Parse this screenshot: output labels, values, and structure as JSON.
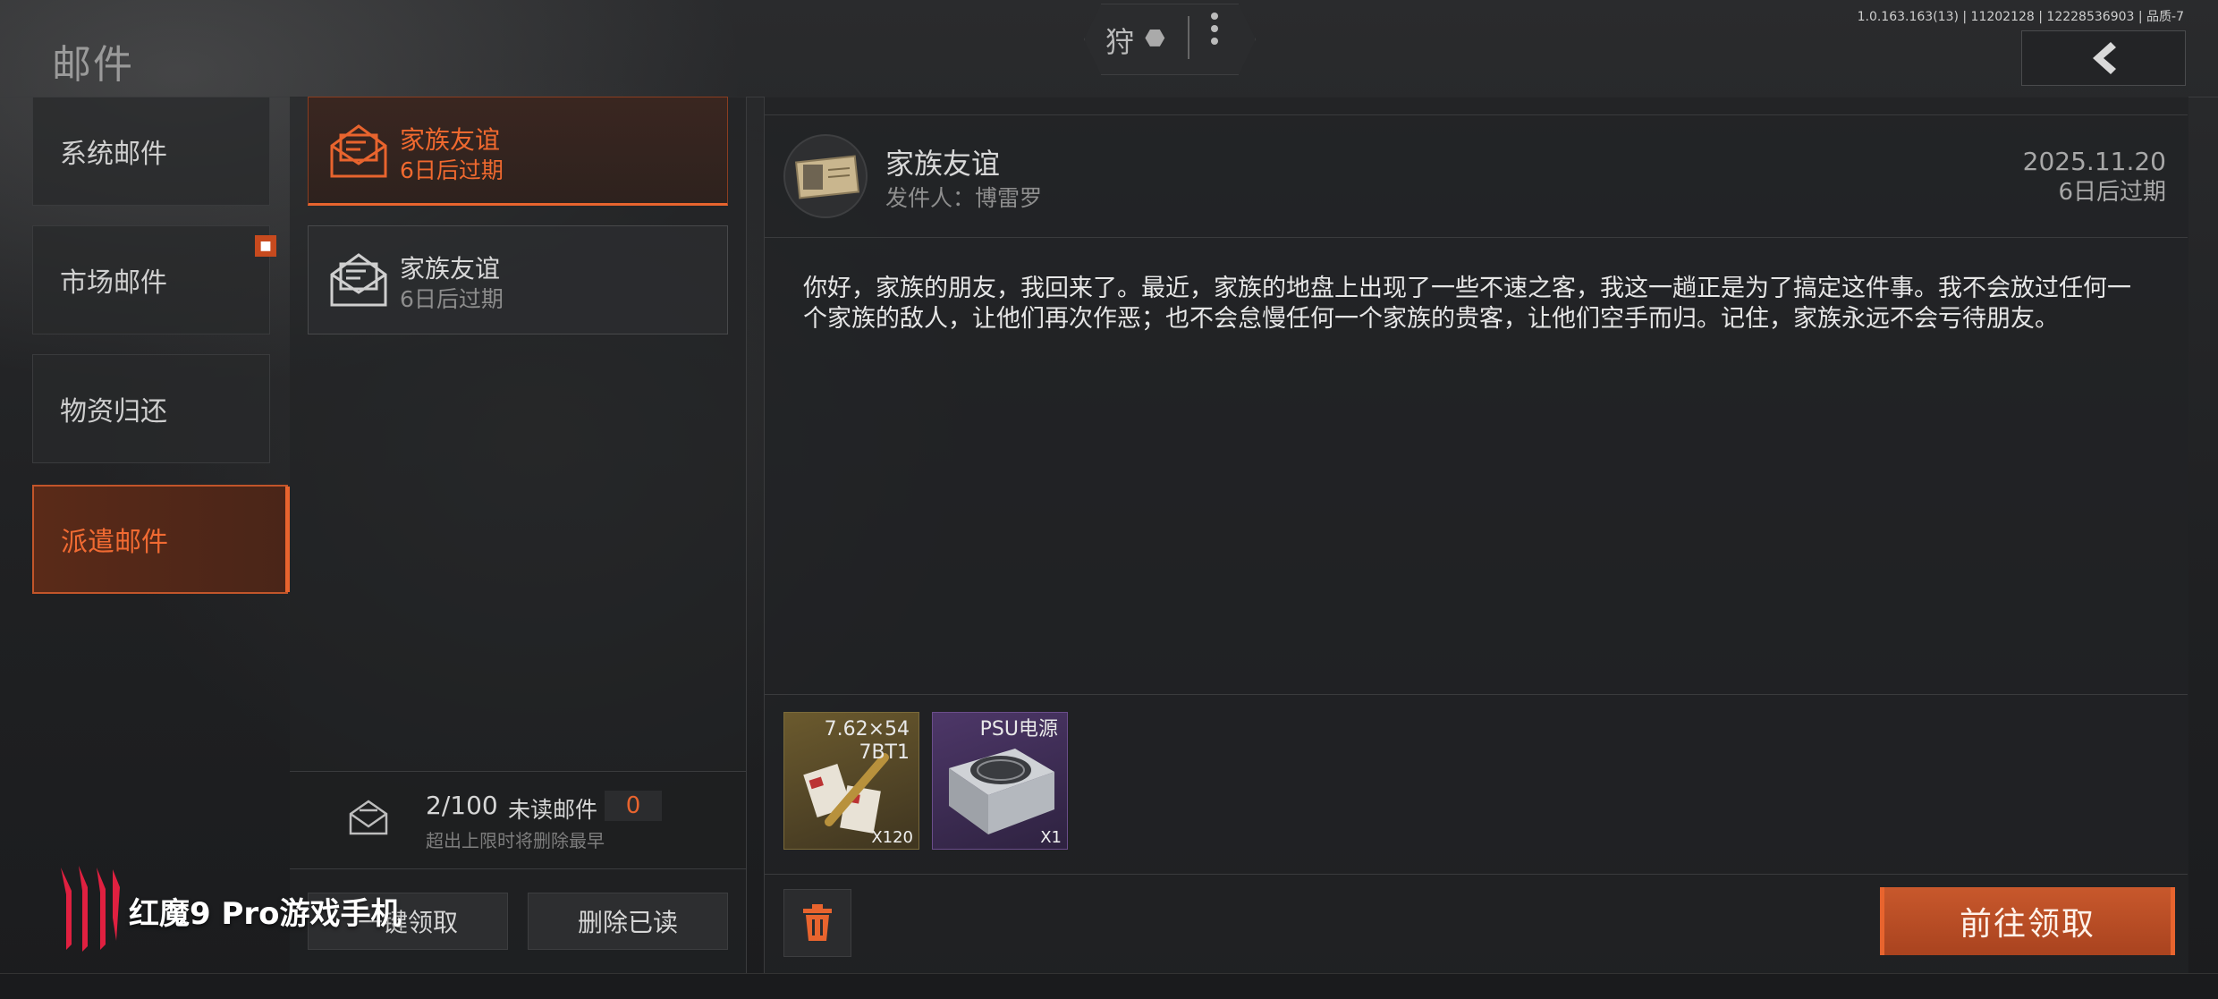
{
  "header": {
    "page_title": "邮件",
    "center_pill_text": "狩",
    "version": "1.0.163.163(13) | 11202128 | 12228536903 | 品质-7",
    "back_icon": "chevron-left-icon"
  },
  "sidebar": {
    "items": [
      {
        "label": "系统邮件",
        "active": false,
        "badge": false
      },
      {
        "label": "市场邮件",
        "active": false,
        "badge": true
      },
      {
        "label": "物资归还",
        "active": false,
        "badge": false
      },
      {
        "label": "派遣邮件",
        "active": true,
        "badge": false
      }
    ]
  },
  "mail_list": {
    "items": [
      {
        "title": "家族友谊",
        "expire": "6日后过期",
        "selected": true,
        "icon": "open-envelope-icon"
      },
      {
        "title": "家族友谊",
        "expire": "6日后过期",
        "selected": false,
        "icon": "open-envelope-icon"
      }
    ],
    "count": "2/100",
    "unread_label": "未读邮件",
    "unread_count": "0",
    "limit_note": "超出上限时将删除最早",
    "claim_all_label": "一键领取",
    "delete_read_label": "删除已读"
  },
  "detail": {
    "title": "家族友谊",
    "sender": "发件人：博雷罗",
    "date": "2025.11.20",
    "expire": "6日后过期",
    "body": "你好，家族的朋友，我回来了。最近，家族的地盘上出现了一些不速之客，我这一趟正是为了搞定这件事。我不会放过任何一个家族的敌人，让他们再次作恶；也不会怠慢任何一个家族的贵客，让他们空手而归。记住，家族永远不会亏待朋友。",
    "attachments": [
      {
        "name_line1": "7.62×54",
        "name_line2": "7BT1",
        "qty": "X120",
        "rarity": "gold"
      },
      {
        "name_line1": "PSU电源",
        "name_line2": "",
        "qty": "X1",
        "rarity": "purple"
      }
    ],
    "claim_label": "前往领取"
  },
  "watermark": {
    "text": "红魔9 Pro游戏手机"
  },
  "colors": {
    "accent": "#e8642e",
    "background": "#1e1f21"
  }
}
